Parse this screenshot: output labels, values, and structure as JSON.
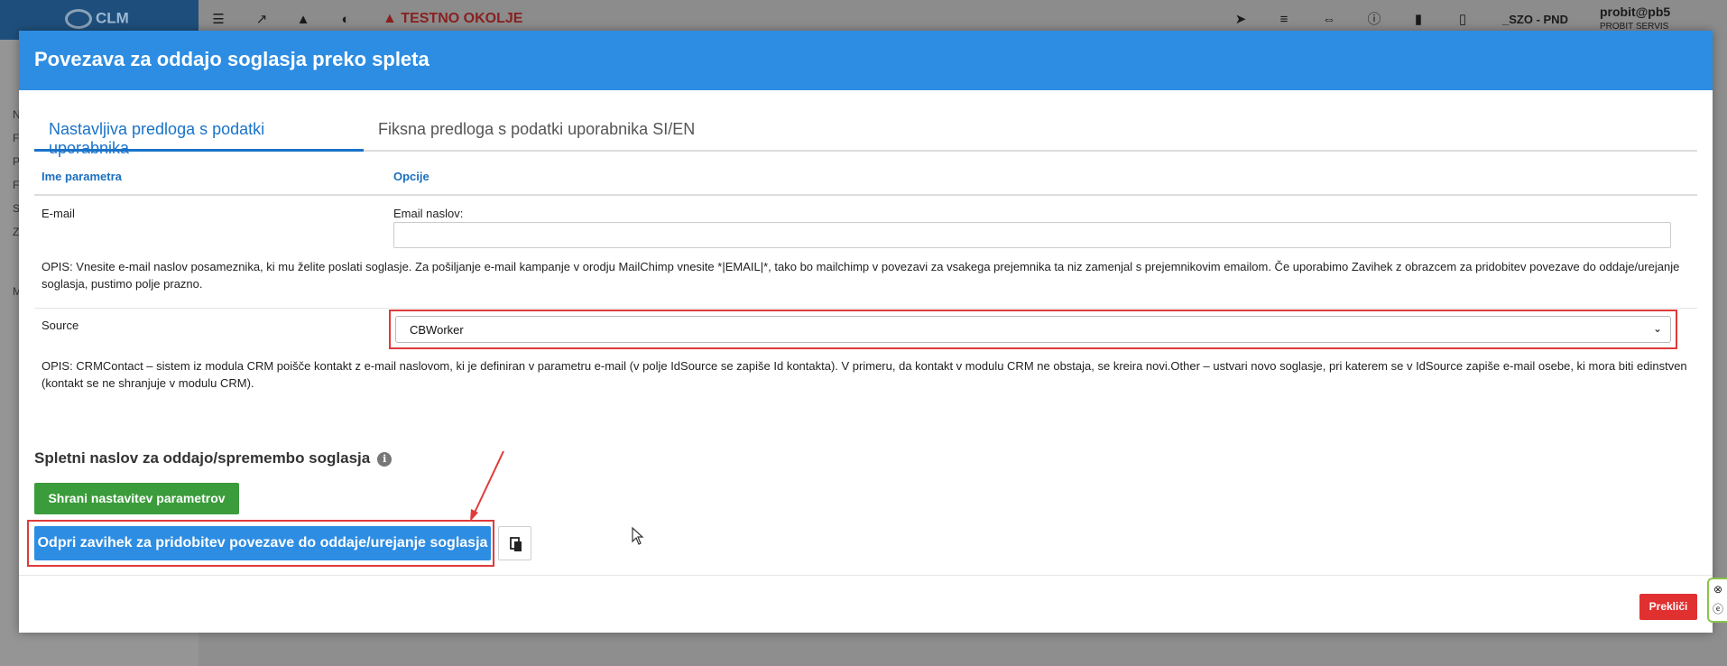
{
  "app": {
    "logo_text": "CLM",
    "environment_warning": "TESTNO OKOLJE",
    "environment": "_SZO - PND",
    "user": "probit@pb5",
    "user_sub": "PROBIT SERVIS",
    "warning_color": "#8a1f1f"
  },
  "modal": {
    "title": "Povezava za oddajo soglasja preko spleta",
    "header_color": "#2d8de3",
    "tabs": [
      {
        "label": "Nastavljiva predloga s podatki uporabnika",
        "active": true
      },
      {
        "label": "Fiksna predloga s podatki uporabnika SI/EN",
        "active": false
      }
    ],
    "table": {
      "col_name": "Ime parametra",
      "col_options": "Opcije",
      "email": {
        "label": "E-mail",
        "field_label": "Email naslov:",
        "value": "",
        "description": "OPIS: Vnesite e-mail naslov posameznika, ki mu želite poslati soglasje. Za pošiljanje e-mail kampanje v orodju MailChimp vnesite *|EMAIL|*, tako bo mailchimp v povezavi za vsakega prejemnika ta niz zamenjal s prejemnikovim emailom. Če uporabimo Zavihek z obrazcem za pridobitev povezave do oddaje/urejanje soglasja, pustimo polje prazno."
      },
      "source": {
        "label": "Source",
        "selected": "CBWorker",
        "description": "OPIS: CRMContact – sistem iz modula CRM poišče kontakt z e-mail naslovom, ki je definiran v parametru e-mail (v polje IdSource se zapiše Id kontakta). V primeru, da kontakt v modulu CRM ne obstaja, se kreira novi.Other – ustvari novo soglasje, pri katerem se v IdSource zapiše e-mail osebe, ki mora biti edinstven (kontakt se ne shranjuje v modulu CRM)."
      }
    },
    "section_title": "Spletni naslov za oddajo/spremembo soglasja",
    "save_button": "Shrani nastavitev parametrov",
    "open_button": "Odpri zavihek za pridobitev povezave do oddaje/urejanje soglasja",
    "cancel_button": "Prekliči",
    "colors": {
      "save": "#3b9c3b",
      "open": "#2d8de3",
      "cancel": "#e03030",
      "highlight": "#e03a3a"
    }
  }
}
